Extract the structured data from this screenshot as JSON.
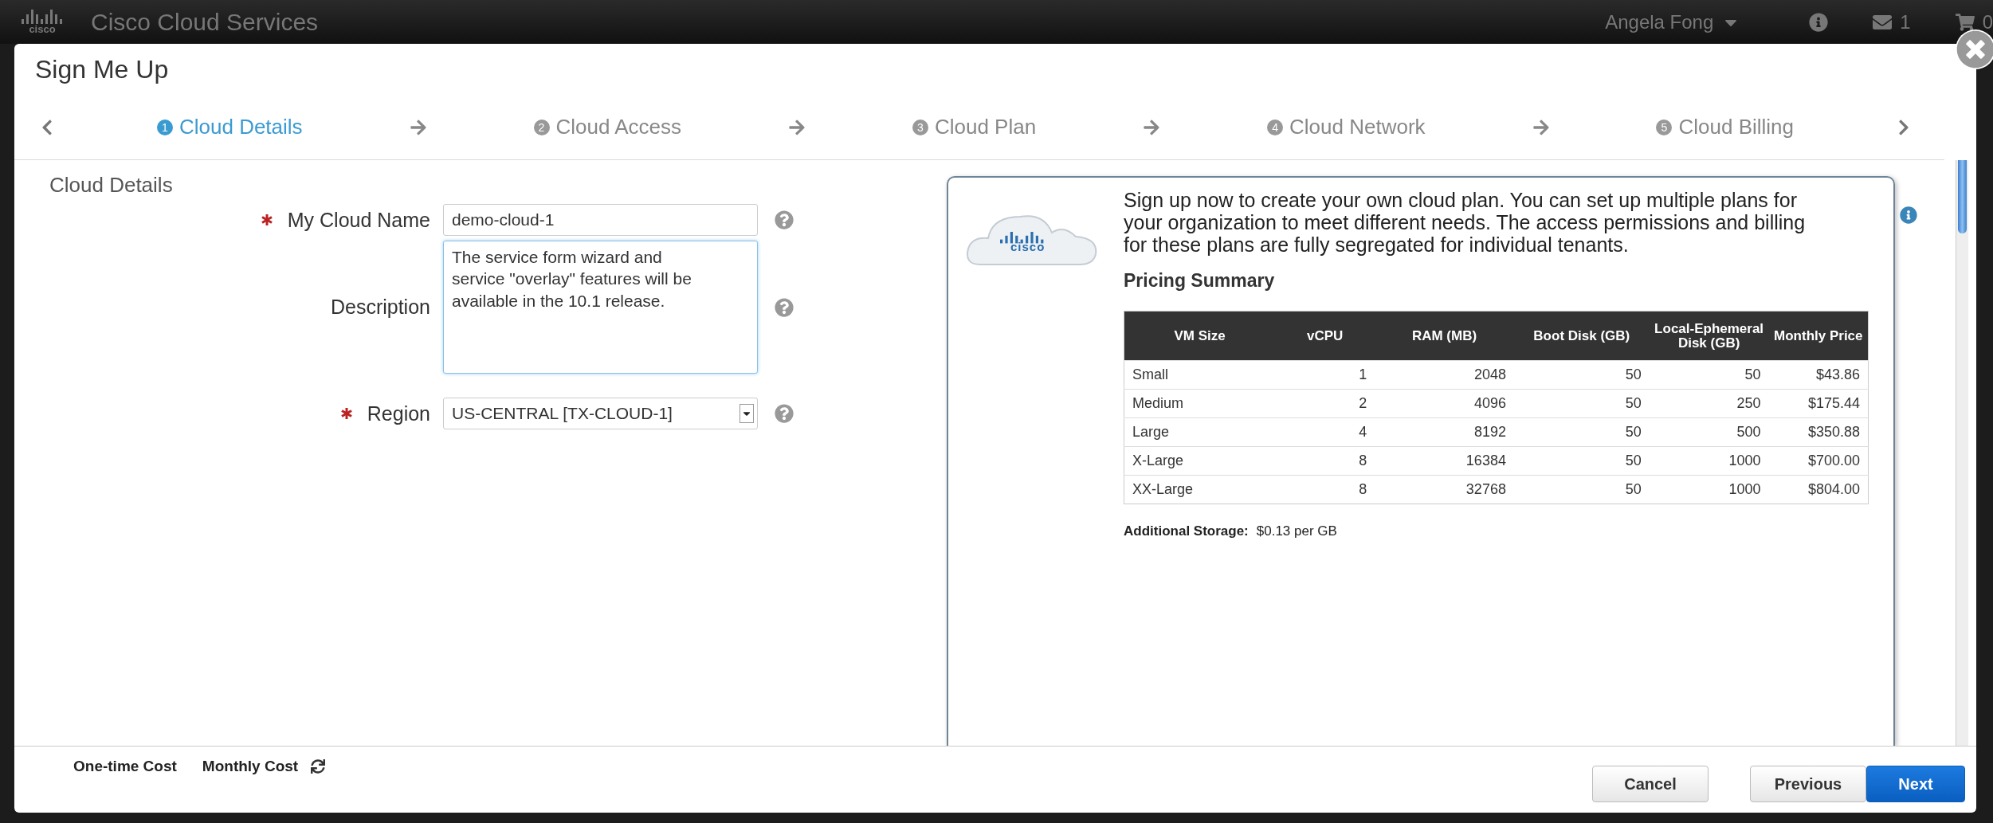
{
  "topbar": {
    "logo_text": "cisco",
    "brand": "Cisco Cloud Services",
    "user": "Angela Fong",
    "messages_count": "1",
    "cart_count": "0"
  },
  "dialog": {
    "title": "Sign Me Up",
    "steps": [
      {
        "number": "1",
        "label": "Cloud Details",
        "selected": true
      },
      {
        "number": "2",
        "label": "Cloud Access",
        "selected": false
      },
      {
        "number": "3",
        "label": "Cloud Plan",
        "selected": false
      },
      {
        "number": "4",
        "label": "Cloud Network",
        "selected": false
      },
      {
        "number": "5",
        "label": "Cloud Billing",
        "selected": false
      }
    ],
    "section_title": "Cloud Details",
    "fields": [
      {
        "kind": "text",
        "label": "My Cloud Name",
        "required": true,
        "value": "demo-cloud-1"
      },
      {
        "kind": "textarea",
        "label": "Description",
        "required": false,
        "value": "The service form wizard and service \"overlay\" features will be available in the 10.1 release."
      },
      {
        "kind": "select",
        "label": "Region",
        "required": true,
        "value": "US-CENTRAL [TX-CLOUD-1]"
      }
    ],
    "info": {
      "logo_text": "cisco",
      "text": "Sign up now to create your own cloud plan. You can set up multiple plans for your organization to meet different needs. The access permissions and billing for these plans are fully segregated for individual tenants.",
      "pricing_title": "Pricing Summary",
      "table": {
        "columns": [
          "VM Size",
          "vCPU",
          "RAM (MB)",
          "Boot Disk (GB)",
          "Local-Ephemeral Disk (GB)",
          "Monthly Price"
        ],
        "rows": [
          [
            "Small",
            "1",
            "2048",
            "50",
            "50",
            "$43.86"
          ],
          [
            "Medium",
            "2",
            "4096",
            "50",
            "250",
            "$175.44"
          ],
          [
            "Large",
            "4",
            "8192",
            "50",
            "500",
            "$350.88"
          ],
          [
            "X-Large",
            "8",
            "16384",
            "50",
            "1000",
            "$700.00"
          ],
          [
            "XX-Large",
            "8",
            "32768",
            "50",
            "1000",
            "$804.00"
          ]
        ]
      },
      "additional_storage": {
        "label": "Additional Storage:",
        "value": "$0.13 per GB"
      }
    },
    "footer": {
      "costs": [
        "One-time Cost",
        "Monthly Cost"
      ],
      "buttons": [
        {
          "kind": "secondary",
          "label": "Cancel"
        },
        {
          "kind": "secondary",
          "label": "Previous"
        },
        {
          "kind": "primary",
          "label": "Next"
        }
      ]
    }
  }
}
